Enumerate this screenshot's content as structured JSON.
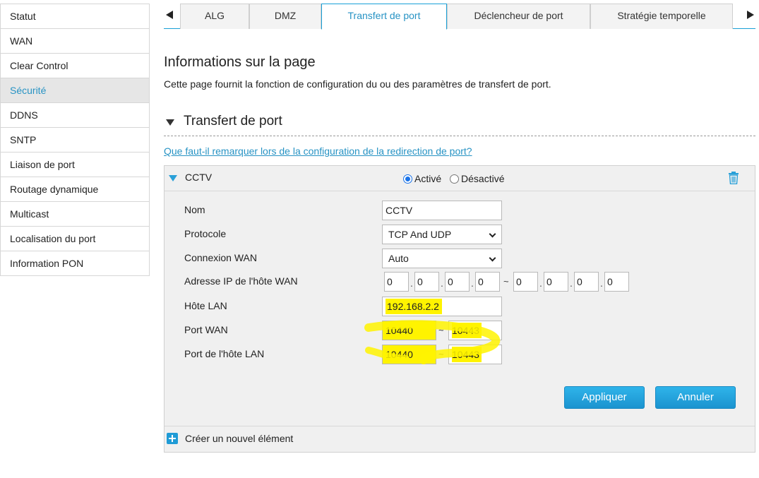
{
  "sidebar": {
    "items": [
      {
        "label": "Statut"
      },
      {
        "label": "WAN"
      },
      {
        "label": "Clear Control"
      },
      {
        "label": "Sécurité"
      },
      {
        "label": "DDNS"
      },
      {
        "label": "SNTP"
      },
      {
        "label": "Liaison de port"
      },
      {
        "label": "Routage dynamique"
      },
      {
        "label": "Multicast"
      },
      {
        "label": "Localisation du port"
      },
      {
        "label": "Information PON"
      }
    ],
    "active_index": 3
  },
  "tabs": [
    {
      "label": "ALG"
    },
    {
      "label": "DMZ"
    },
    {
      "label": "Transfert de port"
    },
    {
      "label": "Déclencheur de port"
    },
    {
      "label": "Stratégie temporelle"
    }
  ],
  "page": {
    "title": "Informations sur la page",
    "description": "Cette page fournit la fonction de configuration du ou des paramètres de transfert de port.",
    "section_title": "Transfert de port",
    "help_link": "Que faut-il remarquer lors de la configuration de la redirection de port?"
  },
  "entry": {
    "name": "CCTV",
    "enabled_label": "Activé",
    "disabled_label": "Désactivé",
    "enabled": true
  },
  "form": {
    "name_label": "Nom",
    "name_value": "CCTV",
    "protocol_label": "Protocole",
    "protocol_value": "TCP And UDP",
    "wan_conn_label": "Connexion WAN",
    "wan_conn_value": "Auto",
    "wan_ip_label": "Adresse IP de l'hôte WAN",
    "wan_ip_start": [
      "0",
      "0",
      "0",
      "0"
    ],
    "wan_ip_end": [
      "0",
      "0",
      "0",
      "0"
    ],
    "lan_host_label": "Hôte LAN",
    "lan_host_value": "192.168.2.2",
    "wan_port_label": "Port WAN",
    "wan_port_start": "10440",
    "wan_port_end": "10443",
    "lan_port_label": "Port de l'hôte LAN",
    "lan_port_start": "10440",
    "lan_port_end": "10443",
    "range_sep": "~",
    "ip_dot": "."
  },
  "buttons": {
    "apply": "Appliquer",
    "cancel": "Annuler"
  },
  "footer": {
    "new_item": "Créer un nouvel élément"
  },
  "colors": {
    "accent": "#2793c4",
    "highlight": "#fff300",
    "button": "#1b93cf"
  }
}
